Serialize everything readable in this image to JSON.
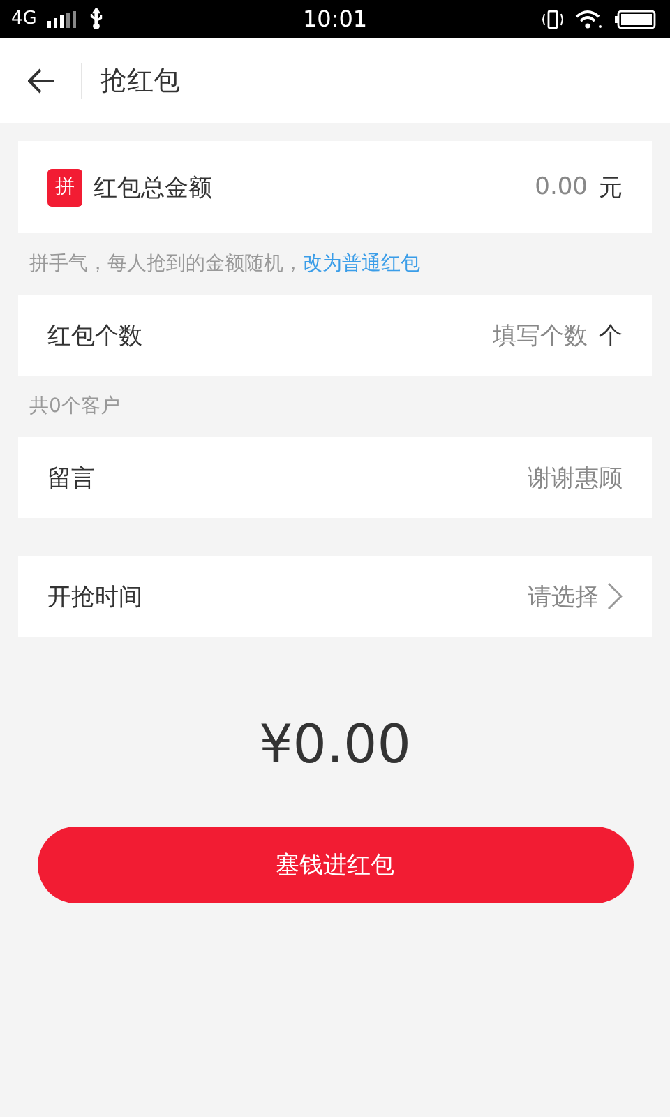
{
  "status_bar": {
    "network": "4G",
    "time": "10:01"
  },
  "header": {
    "title": "抢红包"
  },
  "sections": [
    {
      "kind": "input",
      "badge": "拼",
      "label": "红包总金额",
      "placeholder": "0.00",
      "unit": "元",
      "note": {
        "text": "拼手气，每人抢到的金额随机，",
        "link": "改为普通红包"
      }
    },
    {
      "kind": "input",
      "label": "红包个数",
      "placeholder": "填写个数",
      "unit": "个",
      "note": {
        "text": "共0个客户"
      }
    },
    {
      "kind": "input",
      "label": "留言",
      "placeholder": "谢谢惠顾"
    },
    {
      "kind": "select",
      "label": "开抢时间",
      "placeholder": "请选择"
    }
  ],
  "total": "¥0.00",
  "submit": "塞钱进红包"
}
